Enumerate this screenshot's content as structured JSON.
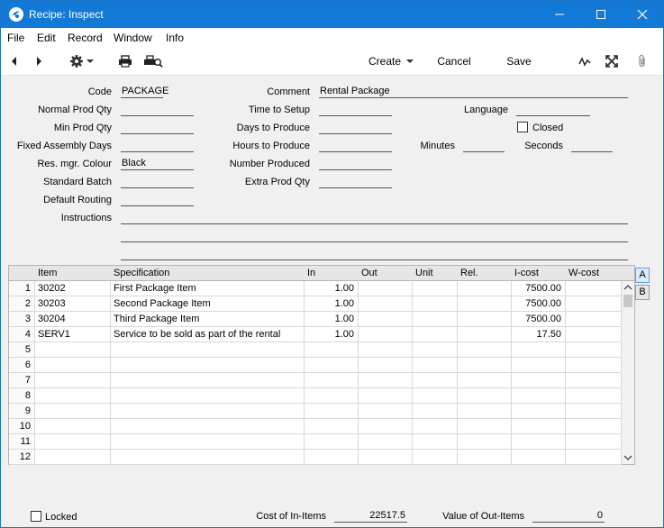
{
  "window": {
    "title": "Recipe: Inspect"
  },
  "menu": [
    "File",
    "Edit",
    "Record",
    "Window",
    "Info"
  ],
  "toolbar": {
    "create": "Create",
    "cancel": "Cancel",
    "save": "Save"
  },
  "form": {
    "code_label": "Code",
    "code": "PACKAGE",
    "comment_label": "Comment",
    "comment": "Rental Package",
    "normal_prod_qty_label": "Normal Prod Qty",
    "normal_prod_qty": "",
    "time_to_setup_label": "Time to Setup",
    "time_to_setup": "",
    "language_label": "Language",
    "language": "",
    "min_prod_qty_label": "Min Prod Qty",
    "min_prod_qty": "",
    "days_to_produce_label": "Days to Produce",
    "days_to_produce": "",
    "closed_label": "Closed",
    "fixed_assembly_days_label": "Fixed Assembly Days",
    "fixed_assembly_days": "",
    "hours_to_produce_label": "Hours to Produce",
    "hours_to_produce": "",
    "minutes_label": "Minutes",
    "minutes": "",
    "seconds_label": "Seconds",
    "seconds": "",
    "res_mgr_colour_label": "Res. mgr. Colour",
    "res_mgr_colour": "Black",
    "number_produced_label": "Number Produced",
    "number_produced": "",
    "standard_batch_label": "Standard Batch",
    "standard_batch": "",
    "extra_prod_qty_label": "Extra Prod Qty",
    "extra_prod_qty": "",
    "default_routing_label": "Default Routing",
    "default_routing": "",
    "instructions_label": "Instructions"
  },
  "grid": {
    "columns": [
      "Item",
      "Specification",
      "In",
      "Out",
      "Unit",
      "Rel.",
      "I-cost",
      "W-cost"
    ],
    "rows": [
      {
        "n": "1",
        "item": "30202",
        "spec": "First Package Item",
        "in": "1.00",
        "icost": "7500.00"
      },
      {
        "n": "2",
        "item": "30203",
        "spec": "Second Package Item",
        "in": "1.00",
        "icost": "7500.00"
      },
      {
        "n": "3",
        "item": "30204",
        "spec": "Third Package Item",
        "in": "1.00",
        "icost": "7500.00"
      },
      {
        "n": "4",
        "item": "SERV1",
        "spec": "Service to be sold as part of the rental",
        "in": "1.00",
        "icost": "17.50"
      },
      {
        "n": "5"
      },
      {
        "n": "6"
      },
      {
        "n": "7"
      },
      {
        "n": "8"
      },
      {
        "n": "9"
      },
      {
        "n": "10"
      },
      {
        "n": "11"
      },
      {
        "n": "12"
      }
    ],
    "tabs": [
      "A",
      "B"
    ]
  },
  "footer": {
    "locked_label": "Locked",
    "cost_in_label": "Cost of In-Items",
    "cost_in": "22517.5",
    "value_out_label": "Value of Out-Items",
    "value_out": "0"
  }
}
